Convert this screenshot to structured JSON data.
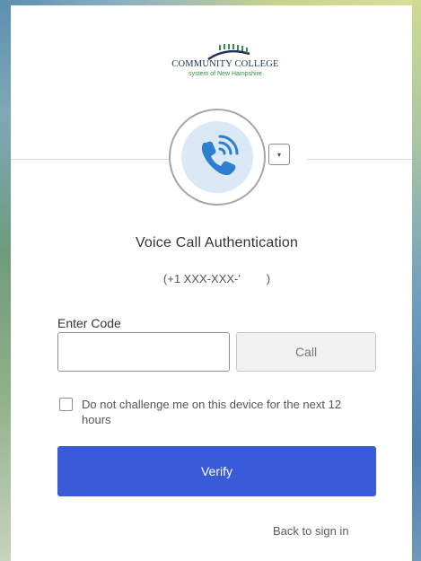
{
  "brand": {
    "name_line1": "COMMUNITY COLLEGE",
    "name_line2": "system of New Hampshire",
    "colors": {
      "navy": "#1d2f5e",
      "green": "#3a8a4a"
    }
  },
  "factor": {
    "icon": "phone-call-icon",
    "dropdown_icon": "▾"
  },
  "title": "Voice Call Authentication",
  "phone_number": "(+1 XXX-XXX-'        )",
  "code_field": {
    "label": "Enter Code",
    "value": "",
    "placeholder": ""
  },
  "call_button": "Call",
  "remember_device": {
    "checked": false,
    "label": "Do not challenge me on this device for the next 12 hours"
  },
  "verify_button": "Verify",
  "back_link": "Back to sign in",
  "colors": {
    "accent": "#3a5bd9",
    "icon_bg": "#dbe8f6",
    "icon_blue": "#2f7fd0"
  }
}
